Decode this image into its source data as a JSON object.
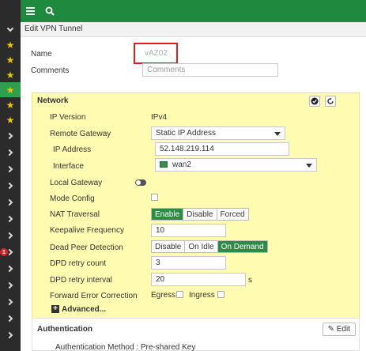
{
  "page": {
    "title": "Edit VPN Tunnel"
  },
  "icons": {
    "menu": "menu-icon",
    "search": "search-icon"
  },
  "sidebar": {
    "badge": "1"
  },
  "form": {
    "name_label": "Name",
    "name_value": "vAZ02",
    "comments_label": "Comments",
    "comments_placeholder": "Comments"
  },
  "network": {
    "title": "Network",
    "ip_version_label": "IP Version",
    "ip_version_value": "IPv4",
    "remote_gateway_label": "Remote Gateway",
    "remote_gateway_value": "Static IP Address",
    "ip_address_label": "IP Address",
    "ip_address_value": "52.148.219.114",
    "interface_label": "Interface",
    "interface_value": "wan2",
    "local_gateway_label": "Local Gateway",
    "mode_config_label": "Mode Config",
    "nat_traversal_label": "NAT Traversal",
    "nat_options": [
      "Enable",
      "Disable",
      "Forced"
    ],
    "nat_selected": "Enable",
    "keepalive_label": "Keepalive Frequency",
    "keepalive_value": "10",
    "dpd_label": "Dead Peer Detection",
    "dpd_options": [
      "Disable",
      "On Idle",
      "On Demand"
    ],
    "dpd_selected": "On Demand",
    "dpd_retry_count_label": "DPD retry count",
    "dpd_retry_count_value": "3",
    "dpd_retry_interval_label": "DPD retry interval",
    "dpd_retry_interval_value": "20",
    "dpd_retry_interval_unit": "s",
    "fec_label": "Forward Error Correction",
    "fec_egress": "Egress",
    "fec_ingress": "Ingress",
    "advanced_label": "Advanced..."
  },
  "authentication": {
    "title": "Authentication",
    "edit_label": "Edit",
    "method_text": "Authentication Method : Pre-shared Key"
  },
  "colors": {
    "topbar": "#1f8a3e",
    "panel": "#fffbb0",
    "accent": "#2f8a47",
    "highlight": "#e21c1c"
  }
}
